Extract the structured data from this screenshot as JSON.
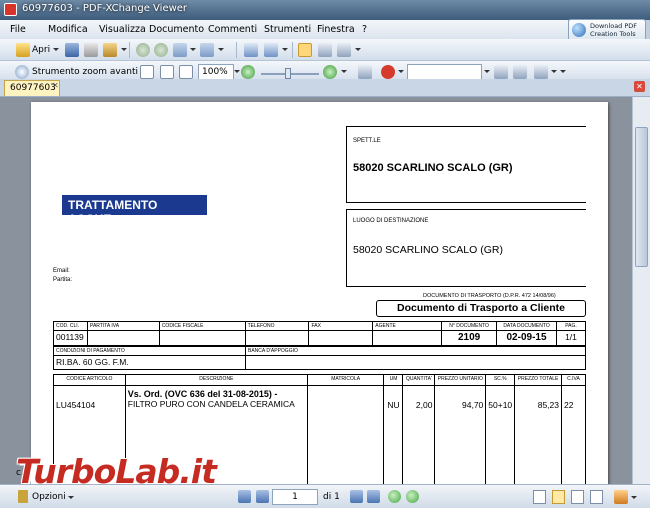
{
  "window": {
    "title": "60977603 - PDF-XChange Viewer"
  },
  "promo": {
    "line1": "Download PDF",
    "line2": "Creation Tools"
  },
  "menu": [
    "File",
    "Modifica",
    "Visualizza",
    "Documento",
    "Commenti",
    "Strumenti",
    "Finestra",
    "?"
  ],
  "toolbar1": {
    "open_label": "Apri"
  },
  "toolbar2": {
    "zoom_tool_label": "Strumento zoom avanti",
    "zoom_value": "100%"
  },
  "tab": {
    "label": "60977603"
  },
  "document": {
    "brand": "TRATTAMENTO ACQUE",
    "email_label": "Email:",
    "partita_label": "Partita:",
    "spett_label": "SPETT.LE",
    "spett_value": "58020 SCARLINO SCALO (GR)",
    "dest_label": "LUOGO DI DESTINAZIONE",
    "dest_value": "58020 SCARLINO SCALO (GR)",
    "ddt_note": "DOCUMENTO DI TRASPORTO (D.P.R. 472 14/08/96)",
    "ddt_title": "Documento di Trasporto a Cliente",
    "header_row": {
      "labels": [
        "COD. CLI.",
        "PARTITA IVA",
        "CODICE FISCALE",
        "TELEFONO",
        "FAX",
        "AGENTE",
        "N° DOCUMENTO",
        "DATA DOCUMENTO",
        "PAG."
      ],
      "values": [
        "001139",
        "",
        "",
        "",
        "",
        "",
        "2109",
        "02-09-15",
        "1/1"
      ]
    },
    "payment": {
      "cond_label": "CONDIZIONI DI PAGAMENTO",
      "cond_value": "RI.BA. 60 GG. F.M.",
      "bank_label": "BANCA D'APPOGGIO",
      "bank_value": ""
    },
    "items": {
      "columns": [
        "CODICE ARTICOLO",
        "DESCRIZIONE",
        "MATRICOLA",
        "UM",
        "QUANTITA'",
        "PREZZO UNITARIO",
        "SC.%",
        "PREZZO TOTALE",
        "C.IVA"
      ],
      "rows": [
        {
          "code": "LU454104",
          "desc_line1": "Vs. Ord. (OVC 636 del 31-08-2015) -",
          "desc_line2": "FILTRO PURO CON CANDELA CERAMICA",
          "matricola": "",
          "um": "NU",
          "qty": "2,00",
          "unit_price": "94,70",
          "discount": "50+10",
          "total": "85,23",
          "iva": "22"
        }
      ]
    }
  },
  "watermark": {
    "text": "TurboLab.it",
    "tail": "c.i"
  },
  "statusbar": {
    "options_label": "Opzioni",
    "page_current": "1",
    "page_of": "di 1"
  }
}
